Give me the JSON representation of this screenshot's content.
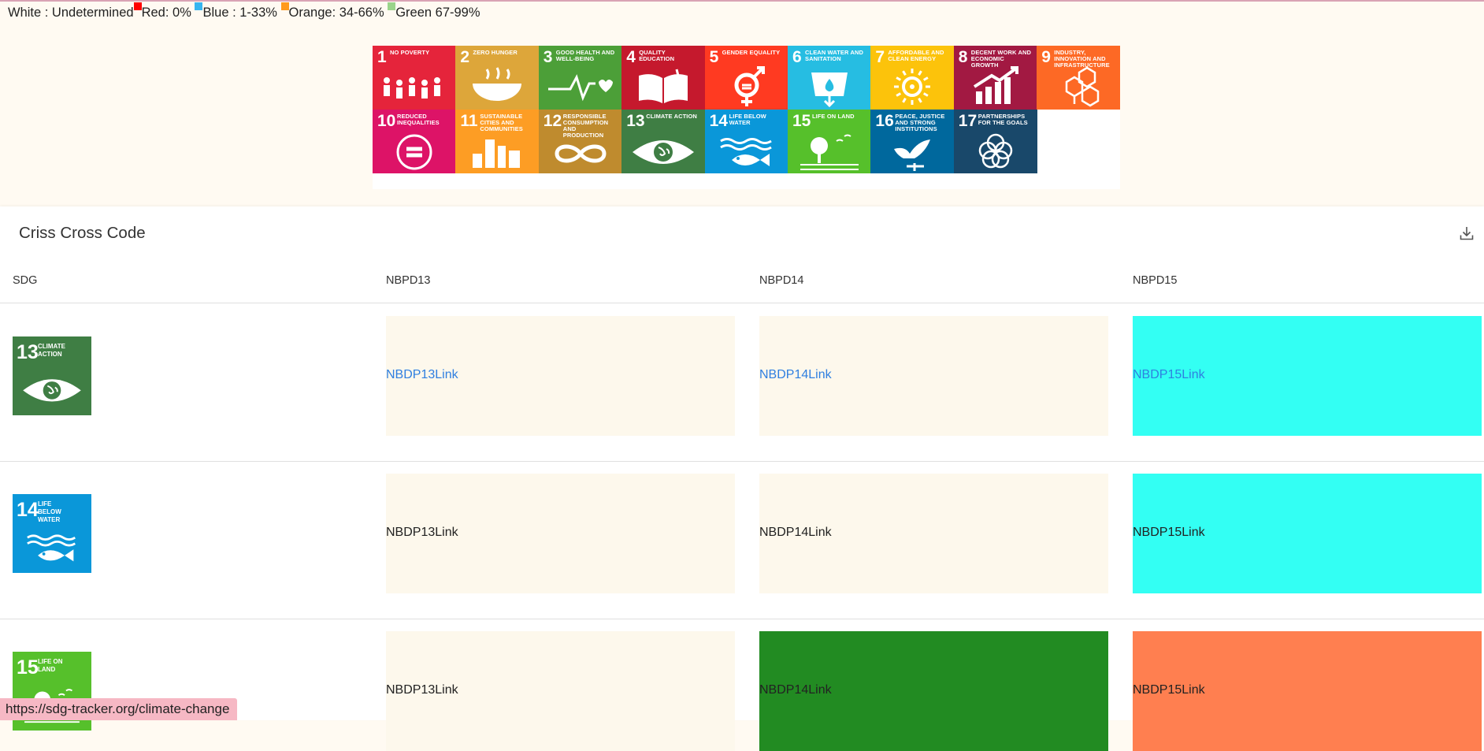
{
  "legend": {
    "white": "White : Undetermined",
    "red": "Red: 0%",
    "blue": "Blue : 1-33%",
    "orange": "Orange: 34-66%",
    "green": "Green 67-99%",
    "colors": {
      "red": "#ff0000",
      "blue": "#36b5f0",
      "orange": "#ff9a1c",
      "green": "#9ad48a"
    }
  },
  "sdg_tiles": [
    {
      "num": "1",
      "title": "NO POVERTY",
      "color": "#e5243b",
      "icon": "people-icon"
    },
    {
      "num": "2",
      "title": "ZERO HUNGER",
      "color": "#dda63a",
      "icon": "bowl-icon"
    },
    {
      "num": "3",
      "title": "GOOD HEALTH AND WELL-BEING",
      "color": "#4c9f38",
      "icon": "heartbeat-icon"
    },
    {
      "num": "4",
      "title": "QUALITY EDUCATION",
      "color": "#c5192d",
      "icon": "book-icon"
    },
    {
      "num": "5",
      "title": "GENDER EQUALITY",
      "color": "#ff3a21",
      "icon": "gender-icon"
    },
    {
      "num": "6",
      "title": "CLEAN WATER AND SANITATION",
      "color": "#26bde2",
      "icon": "water-drop-icon"
    },
    {
      "num": "7",
      "title": "AFFORDABLE AND CLEAN ENERGY",
      "color": "#fcc30b",
      "icon": "sun-icon"
    },
    {
      "num": "8",
      "title": "DECENT WORK AND ECONOMIC GROWTH",
      "color": "#a21942",
      "icon": "growth-chart-icon"
    },
    {
      "num": "9",
      "title": "INDUSTRY, INNOVATION AND INFRASTRUCTURE",
      "color": "#fd6925",
      "icon": "cubes-icon"
    },
    {
      "num": "10",
      "title": "REDUCED INEQUALITIES",
      "color": "#dd1367",
      "icon": "equals-icon"
    },
    {
      "num": "11",
      "title": "SUSTAINABLE CITIES AND COMMUNITIES",
      "color": "#fd9d24",
      "icon": "city-icon"
    },
    {
      "num": "12",
      "title": "RESPONSIBLE CONSUMPTION AND PRODUCTION",
      "color": "#bf8b2e",
      "icon": "infinity-icon"
    },
    {
      "num": "13",
      "title": "CLIMATE ACTION",
      "color": "#3f7e44",
      "icon": "eye-globe-icon"
    },
    {
      "num": "14",
      "title": "LIFE BELOW WATER",
      "color": "#0a97d9",
      "icon": "fish-icon"
    },
    {
      "num": "15",
      "title": "LIFE ON LAND",
      "color": "#56c02b",
      "icon": "tree-icon"
    },
    {
      "num": "16",
      "title": "PEACE, JUSTICE AND STRONG INSTITUTIONS",
      "color": "#00689d",
      "icon": "dove-icon"
    },
    {
      "num": "17",
      "title": "PARTNERSHIPS FOR THE GOALS",
      "color": "#19486a",
      "icon": "rings-icon"
    }
  ],
  "panel": {
    "title": "Criss Cross Code",
    "download_icon": "download-icon",
    "headers": [
      "SDG",
      "NBPD13",
      "NBPD14",
      "NBPD15"
    ]
  },
  "rows": [
    {
      "sdg": {
        "num": "13",
        "title": "CLIMATE ACTION",
        "color": "#3f7e44",
        "icon": "eye-globe-icon"
      },
      "cells": [
        {
          "label": "NBDP13Link",
          "bg": "#fdf8ec",
          "style": "link"
        },
        {
          "label": "NBDP14Link",
          "bg": "#fdf8ec",
          "style": "link"
        },
        {
          "label": "NBDP15Link",
          "bg": "#33fff3",
          "style": "link"
        }
      ]
    },
    {
      "sdg": {
        "num": "14",
        "title": "LIFE BELOW WATER",
        "color": "#0a97d9",
        "icon": "fish-icon"
      },
      "cells": [
        {
          "label": "NBDP13Link",
          "bg": "#fdf8ec",
          "style": "plain"
        },
        {
          "label": "NBDP14Link",
          "bg": "#fdf8ec",
          "style": "plain"
        },
        {
          "label": "NBDP15Link",
          "bg": "#33fff3",
          "style": "plain"
        }
      ]
    },
    {
      "sdg": {
        "num": "15",
        "title": "LIFE ON LAND",
        "color": "#56c02b",
        "icon": "tree-icon"
      },
      "cells": [
        {
          "label": "NBDP13Link",
          "bg": "#fdf8ec",
          "style": "plain"
        },
        {
          "label": "NBDP14Link",
          "bg": "#228b22",
          "style": "plain"
        },
        {
          "label": "NBDP15Link",
          "bg": "#ff7f50",
          "style": "plain"
        }
      ]
    }
  ],
  "status_url": "https://sdg-tracker.org/climate-change"
}
